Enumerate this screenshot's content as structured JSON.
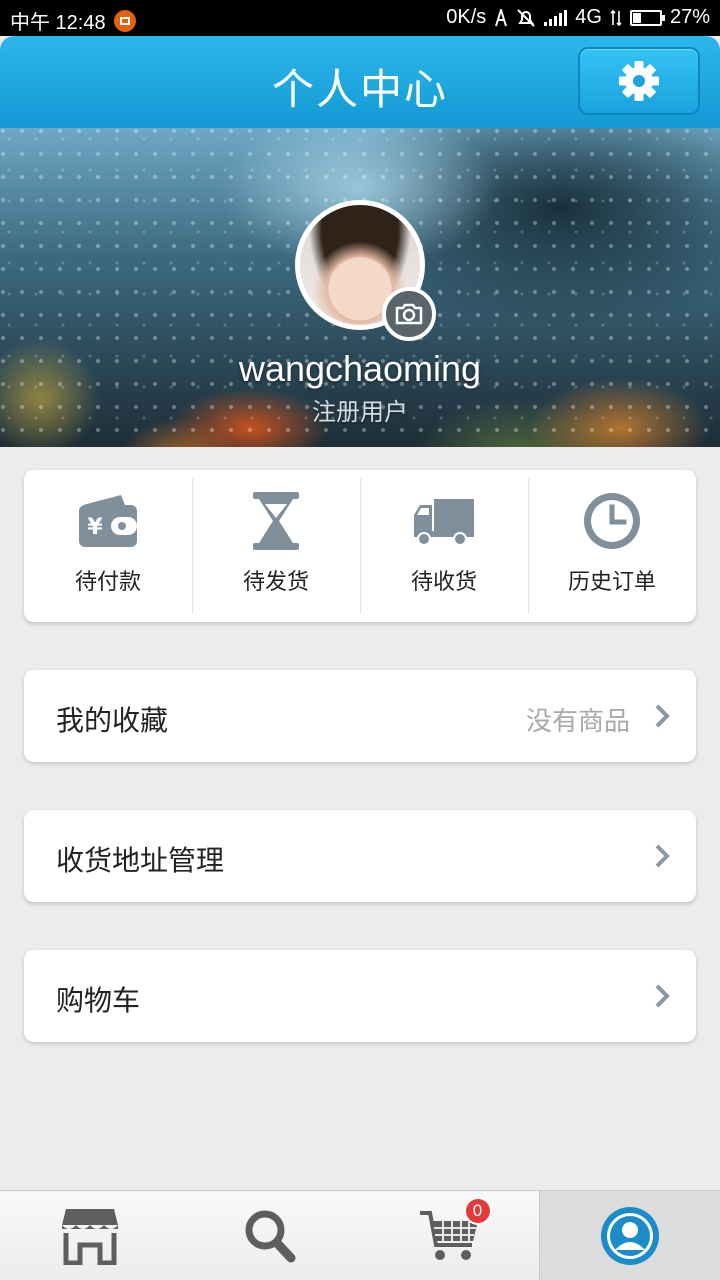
{
  "status_bar": {
    "time": "中午 12:48",
    "net_speed": "0K/s",
    "network": "4G",
    "battery_percent": "27%",
    "battery_level": 0.27
  },
  "header": {
    "title": "个人中心",
    "settings_icon": "gear-icon"
  },
  "profile": {
    "username": "wangchaoming",
    "role": "注册用户"
  },
  "orders": [
    {
      "label": "待付款",
      "icon": "wallet-icon"
    },
    {
      "label": "待发货",
      "icon": "hourglass-icon"
    },
    {
      "label": "待收货",
      "icon": "truck-icon"
    },
    {
      "label": "历史订单",
      "icon": "clock-icon"
    }
  ],
  "menu": [
    {
      "label": "我的收藏",
      "value": "没有商品"
    },
    {
      "label": "收货地址管理",
      "value": ""
    },
    {
      "label": "购物车",
      "value": ""
    }
  ],
  "bottom_nav": {
    "tabs": [
      {
        "icon": "store-icon"
      },
      {
        "icon": "search-icon"
      },
      {
        "icon": "cart-icon",
        "badge": "0"
      },
      {
        "icon": "user-icon",
        "active": true
      }
    ]
  },
  "colors": {
    "header_blue": "#1ea8e0",
    "icon_gray": "#7f8f9c",
    "badge_red": "#e23b3b"
  }
}
